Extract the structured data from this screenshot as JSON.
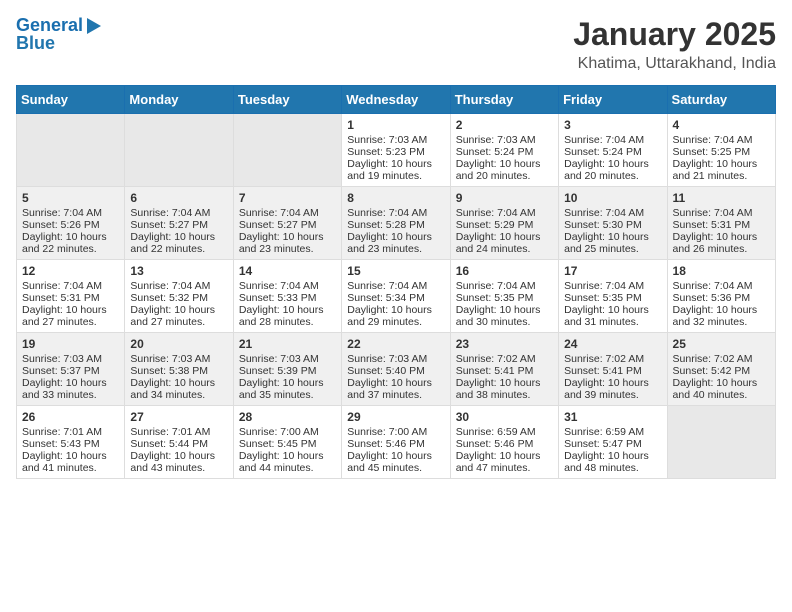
{
  "header": {
    "logo_line1": "General",
    "logo_line2": "Blue",
    "title": "January 2025",
    "subtitle": "Khatima, Uttarakhand, India"
  },
  "weekdays": [
    "Sunday",
    "Monday",
    "Tuesday",
    "Wednesday",
    "Thursday",
    "Friday",
    "Saturday"
  ],
  "weeks": [
    [
      {
        "day": "",
        "sunrise": "",
        "sunset": "",
        "daylight": "",
        "empty": true
      },
      {
        "day": "",
        "sunrise": "",
        "sunset": "",
        "daylight": "",
        "empty": true
      },
      {
        "day": "",
        "sunrise": "",
        "sunset": "",
        "daylight": "",
        "empty": true
      },
      {
        "day": "1",
        "sunrise": "Sunrise: 7:03 AM",
        "sunset": "Sunset: 5:23 PM",
        "daylight": "Daylight: 10 hours and 19 minutes."
      },
      {
        "day": "2",
        "sunrise": "Sunrise: 7:03 AM",
        "sunset": "Sunset: 5:24 PM",
        "daylight": "Daylight: 10 hours and 20 minutes."
      },
      {
        "day": "3",
        "sunrise": "Sunrise: 7:04 AM",
        "sunset": "Sunset: 5:24 PM",
        "daylight": "Daylight: 10 hours and 20 minutes."
      },
      {
        "day": "4",
        "sunrise": "Sunrise: 7:04 AM",
        "sunset": "Sunset: 5:25 PM",
        "daylight": "Daylight: 10 hours and 21 minutes."
      }
    ],
    [
      {
        "day": "5",
        "sunrise": "Sunrise: 7:04 AM",
        "sunset": "Sunset: 5:26 PM",
        "daylight": "Daylight: 10 hours and 22 minutes."
      },
      {
        "day": "6",
        "sunrise": "Sunrise: 7:04 AM",
        "sunset": "Sunset: 5:27 PM",
        "daylight": "Daylight: 10 hours and 22 minutes."
      },
      {
        "day": "7",
        "sunrise": "Sunrise: 7:04 AM",
        "sunset": "Sunset: 5:27 PM",
        "daylight": "Daylight: 10 hours and 23 minutes."
      },
      {
        "day": "8",
        "sunrise": "Sunrise: 7:04 AM",
        "sunset": "Sunset: 5:28 PM",
        "daylight": "Daylight: 10 hours and 23 minutes."
      },
      {
        "day": "9",
        "sunrise": "Sunrise: 7:04 AM",
        "sunset": "Sunset: 5:29 PM",
        "daylight": "Daylight: 10 hours and 24 minutes."
      },
      {
        "day": "10",
        "sunrise": "Sunrise: 7:04 AM",
        "sunset": "Sunset: 5:30 PM",
        "daylight": "Daylight: 10 hours and 25 minutes."
      },
      {
        "day": "11",
        "sunrise": "Sunrise: 7:04 AM",
        "sunset": "Sunset: 5:31 PM",
        "daylight": "Daylight: 10 hours and 26 minutes."
      }
    ],
    [
      {
        "day": "12",
        "sunrise": "Sunrise: 7:04 AM",
        "sunset": "Sunset: 5:31 PM",
        "daylight": "Daylight: 10 hours and 27 minutes."
      },
      {
        "day": "13",
        "sunrise": "Sunrise: 7:04 AM",
        "sunset": "Sunset: 5:32 PM",
        "daylight": "Daylight: 10 hours and 27 minutes."
      },
      {
        "day": "14",
        "sunrise": "Sunrise: 7:04 AM",
        "sunset": "Sunset: 5:33 PM",
        "daylight": "Daylight: 10 hours and 28 minutes."
      },
      {
        "day": "15",
        "sunrise": "Sunrise: 7:04 AM",
        "sunset": "Sunset: 5:34 PM",
        "daylight": "Daylight: 10 hours and 29 minutes."
      },
      {
        "day": "16",
        "sunrise": "Sunrise: 7:04 AM",
        "sunset": "Sunset: 5:35 PM",
        "daylight": "Daylight: 10 hours and 30 minutes."
      },
      {
        "day": "17",
        "sunrise": "Sunrise: 7:04 AM",
        "sunset": "Sunset: 5:35 PM",
        "daylight": "Daylight: 10 hours and 31 minutes."
      },
      {
        "day": "18",
        "sunrise": "Sunrise: 7:04 AM",
        "sunset": "Sunset: 5:36 PM",
        "daylight": "Daylight: 10 hours and 32 minutes."
      }
    ],
    [
      {
        "day": "19",
        "sunrise": "Sunrise: 7:03 AM",
        "sunset": "Sunset: 5:37 PM",
        "daylight": "Daylight: 10 hours and 33 minutes."
      },
      {
        "day": "20",
        "sunrise": "Sunrise: 7:03 AM",
        "sunset": "Sunset: 5:38 PM",
        "daylight": "Daylight: 10 hours and 34 minutes."
      },
      {
        "day": "21",
        "sunrise": "Sunrise: 7:03 AM",
        "sunset": "Sunset: 5:39 PM",
        "daylight": "Daylight: 10 hours and 35 minutes."
      },
      {
        "day": "22",
        "sunrise": "Sunrise: 7:03 AM",
        "sunset": "Sunset: 5:40 PM",
        "daylight": "Daylight: 10 hours and 37 minutes."
      },
      {
        "day": "23",
        "sunrise": "Sunrise: 7:02 AM",
        "sunset": "Sunset: 5:41 PM",
        "daylight": "Daylight: 10 hours and 38 minutes."
      },
      {
        "day": "24",
        "sunrise": "Sunrise: 7:02 AM",
        "sunset": "Sunset: 5:41 PM",
        "daylight": "Daylight: 10 hours and 39 minutes."
      },
      {
        "day": "25",
        "sunrise": "Sunrise: 7:02 AM",
        "sunset": "Sunset: 5:42 PM",
        "daylight": "Daylight: 10 hours and 40 minutes."
      }
    ],
    [
      {
        "day": "26",
        "sunrise": "Sunrise: 7:01 AM",
        "sunset": "Sunset: 5:43 PM",
        "daylight": "Daylight: 10 hours and 41 minutes."
      },
      {
        "day": "27",
        "sunrise": "Sunrise: 7:01 AM",
        "sunset": "Sunset: 5:44 PM",
        "daylight": "Daylight: 10 hours and 43 minutes."
      },
      {
        "day": "28",
        "sunrise": "Sunrise: 7:00 AM",
        "sunset": "Sunset: 5:45 PM",
        "daylight": "Daylight: 10 hours and 44 minutes."
      },
      {
        "day": "29",
        "sunrise": "Sunrise: 7:00 AM",
        "sunset": "Sunset: 5:46 PM",
        "daylight": "Daylight: 10 hours and 45 minutes."
      },
      {
        "day": "30",
        "sunrise": "Sunrise: 6:59 AM",
        "sunset": "Sunset: 5:46 PM",
        "daylight": "Daylight: 10 hours and 47 minutes."
      },
      {
        "day": "31",
        "sunrise": "Sunrise: 6:59 AM",
        "sunset": "Sunset: 5:47 PM",
        "daylight": "Daylight: 10 hours and 48 minutes."
      },
      {
        "day": "",
        "sunrise": "",
        "sunset": "",
        "daylight": "",
        "empty": true
      }
    ]
  ]
}
